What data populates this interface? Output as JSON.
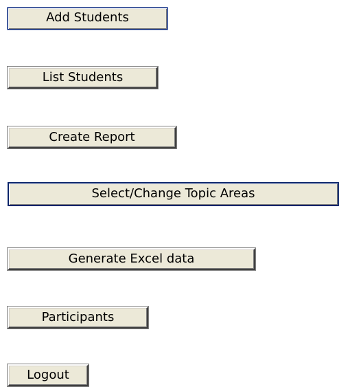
{
  "menu": {
    "add_students": "Add Students",
    "list_students": "List Students",
    "create_report": "Create Report",
    "select_change_topic_areas": "Select/Change Topic Areas",
    "generate_excel_data": "Generate Excel data",
    "participants": "Participants",
    "logout": "Logout"
  },
  "colors": {
    "button_face": "#ece9d8",
    "focus_border": "#0a246a",
    "text": "#000000",
    "background": "#ffffff"
  }
}
